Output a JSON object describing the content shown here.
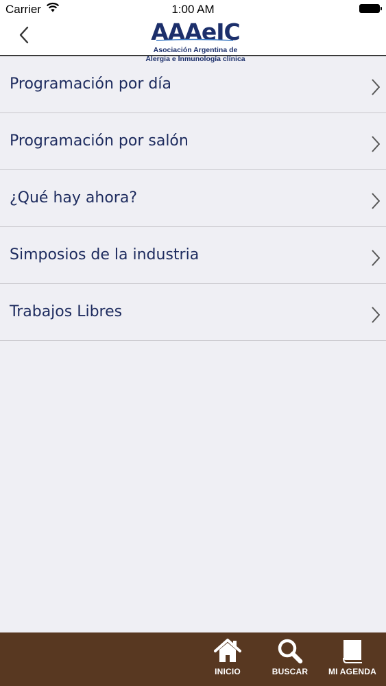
{
  "status_bar": {
    "carrier": "Carrier",
    "time": "1:00 AM"
  },
  "header": {
    "logo_text": "AAAeIC",
    "logo_sub_1": "Asociación Argentina de",
    "logo_sub_2": "Alergia e Inmunología clínica"
  },
  "menu": {
    "items": [
      {
        "label": "Programación por día"
      },
      {
        "label": "Programación por salón"
      },
      {
        "label": "¿Qué hay ahora?"
      },
      {
        "label": "Simposios de la industria"
      },
      {
        "label": "Trabajos Libres"
      }
    ]
  },
  "tab_bar": {
    "tabs": [
      {
        "label": "INICIO",
        "icon": "home-icon"
      },
      {
        "label": "BUSCAR",
        "icon": "search-icon"
      },
      {
        "label": "MI AGENDA",
        "icon": "book-icon"
      }
    ]
  },
  "colors": {
    "brand_navy": "#1c2f6b",
    "label_text": "#1d2b5e",
    "tab_bar_bg": "#583821",
    "background": "#efeff4",
    "separator": "#c8c7cc"
  }
}
